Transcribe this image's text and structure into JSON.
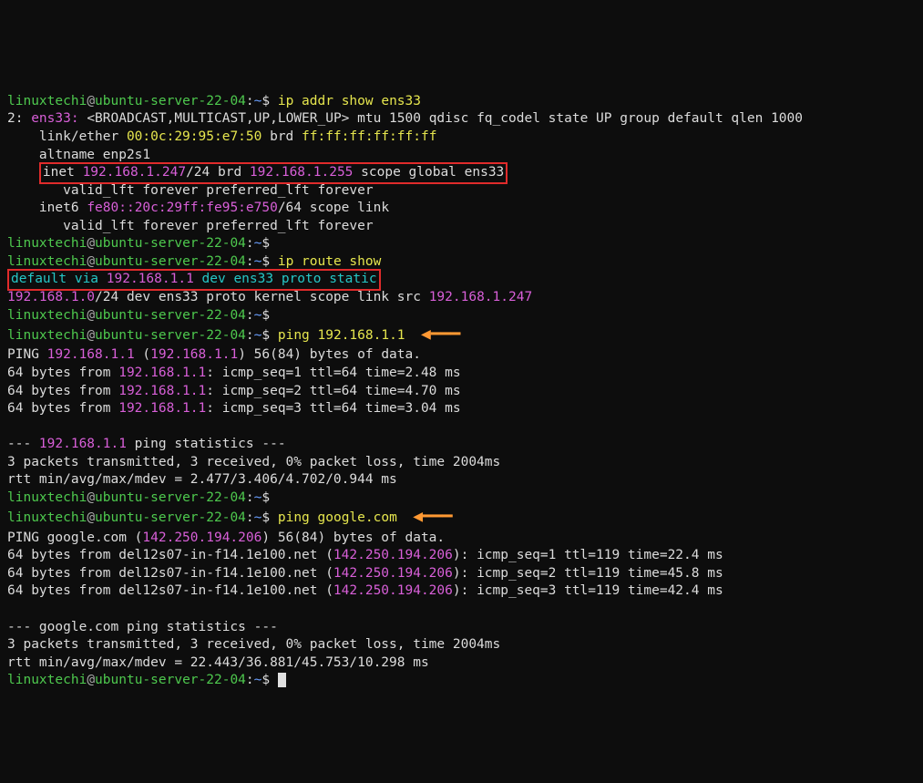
{
  "prompt": {
    "user": "linuxtechi",
    "at": "@",
    "host": "ubuntu-server-22-04",
    "colon": ":",
    "cwd": "~",
    "sym": "$"
  },
  "cmds": {
    "ip_addr": "ip addr show ens33",
    "ip_route": "ip route show",
    "ping_gw": "ping 192.168.1.1",
    "ping_google": "ping google.com"
  },
  "ipaddr": {
    "iface_num": "2: ",
    "iface": "ens33:",
    "flags": " <BROADCAST,MULTICAST,UP,LOWER_UP> mtu 1500 qdisc fq_codel state UP group default qlen 1000",
    "link_pre": "    link/ether ",
    "mac": "00:0c:29:95:e7:50",
    "brd_lbl": " brd ",
    "brd_mac": "ff:ff:ff:ff:ff:ff",
    "altname": "    altname enp2s1",
    "inet_pre": "inet ",
    "inet_addr": "192.168.1.247",
    "inet_mask": "/24 brd ",
    "inet_brd": "192.168.1.255",
    "inet_post": " scope global ens33",
    "valid4": "       valid_lft forever preferred_lft forever",
    "inet6_pre": "    inet6 ",
    "inet6_addr": "fe80::20c:29ff:fe95:e750",
    "inet6_post": "/64 scope link",
    "valid6": "       valid_lft forever preferred_lft forever"
  },
  "route": {
    "def_pre": "default via ",
    "def_gw": "192.168.1.1",
    "def_mid": " dev ens33 ",
    "def_proto": "proto static",
    "net": "192.168.1.0",
    "net_post": "/24 dev ens33 proto kernel scope link src ",
    "net_src": "192.168.1.247"
  },
  "ping1": {
    "hdr_pre": "PING ",
    "hdr_host": "192.168.1.1",
    "hdr_paren": " (",
    "hdr_ip": "192.168.1.1",
    "hdr_post": ") 56(84) bytes of data.",
    "ln1_pre": "64 bytes from ",
    "ln1_ip": "192.168.1.1",
    "ln1_post": ": icmp_seq=1 ttl=64 time=2.48 ms",
    "ln2_pre": "64 bytes from ",
    "ln2_ip": "192.168.1.1",
    "ln2_post": ": icmp_seq=2 ttl=64 time=4.70 ms",
    "ln3_pre": "64 bytes from ",
    "ln3_ip": "192.168.1.1",
    "ln3_post": ": icmp_seq=3 ttl=64 time=3.04 ms",
    "stat_pre": "--- ",
    "stat_host": "192.168.1.1",
    "stat_post": " ping statistics ---",
    "stat_l1": "3 packets transmitted, 3 received, 0% packet loss, time 2004ms",
    "stat_l2": "rtt min/avg/max/mdev = 2.477/3.406/4.702/0.944 ms"
  },
  "ping2": {
    "hdr_pre": "PING google.com (",
    "hdr_ip": "142.250.194.206",
    "hdr_post": ") 56(84) bytes of data.",
    "ln1_pre": "64 bytes from del12s07-in-f14.1e100.net (",
    "ln1_ip": "142.250.194.206",
    "ln1_post": "): icmp_seq=1 ttl=119 time=22.4 ms",
    "ln2_pre": "64 bytes from del12s07-in-f14.1e100.net (",
    "ln2_ip": "142.250.194.206",
    "ln2_post": "): icmp_seq=2 ttl=119 time=45.8 ms",
    "ln3_pre": "64 bytes from del12s07-in-f14.1e100.net (",
    "ln3_ip": "142.250.194.206",
    "ln3_post": "): icmp_seq=3 ttl=119 time=42.4 ms",
    "stat_l0": "--- google.com ping statistics ---",
    "stat_l1": "3 packets transmitted, 3 received, 0% packet loss, time 2004ms",
    "stat_l2": "rtt min/avg/max/mdev = 22.443/36.881/45.753/10.298 ms"
  },
  "annot": {
    "arrow": "◀━━━"
  }
}
